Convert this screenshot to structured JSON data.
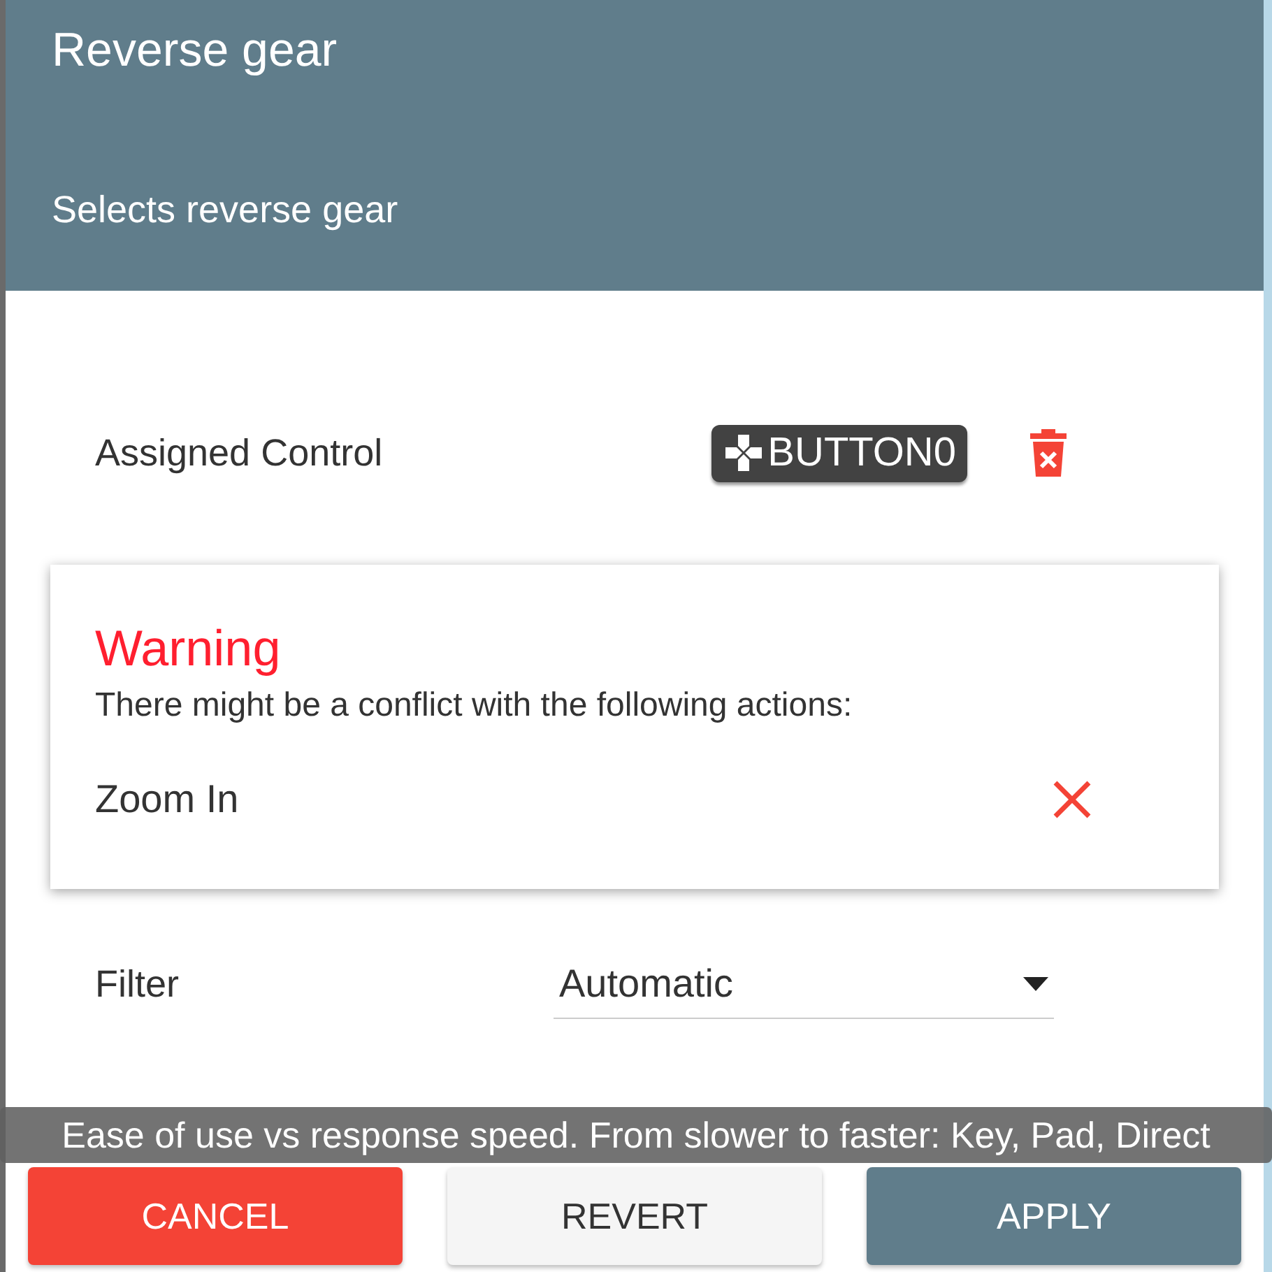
{
  "dialog": {
    "title": "Reverse gear",
    "description": "Selects reverse gear"
  },
  "assigned_control": {
    "label": "Assigned Control",
    "binding": "BUTTON0"
  },
  "warning": {
    "title": "Warning",
    "message": "There might be a conflict with the following actions:",
    "conflicts": [
      {
        "action": "Zoom In"
      }
    ]
  },
  "filter": {
    "label": "Filter",
    "value": "Automatic"
  },
  "tooltip": "Ease of use vs response speed. From slower to faster: Key, Pad, Direct",
  "buttons": [
    {
      "label": "CANCEL",
      "kind": "danger"
    },
    {
      "label": "REVERT",
      "kind": "neutral"
    },
    {
      "label": "APPLY",
      "kind": "primary"
    }
  ]
}
